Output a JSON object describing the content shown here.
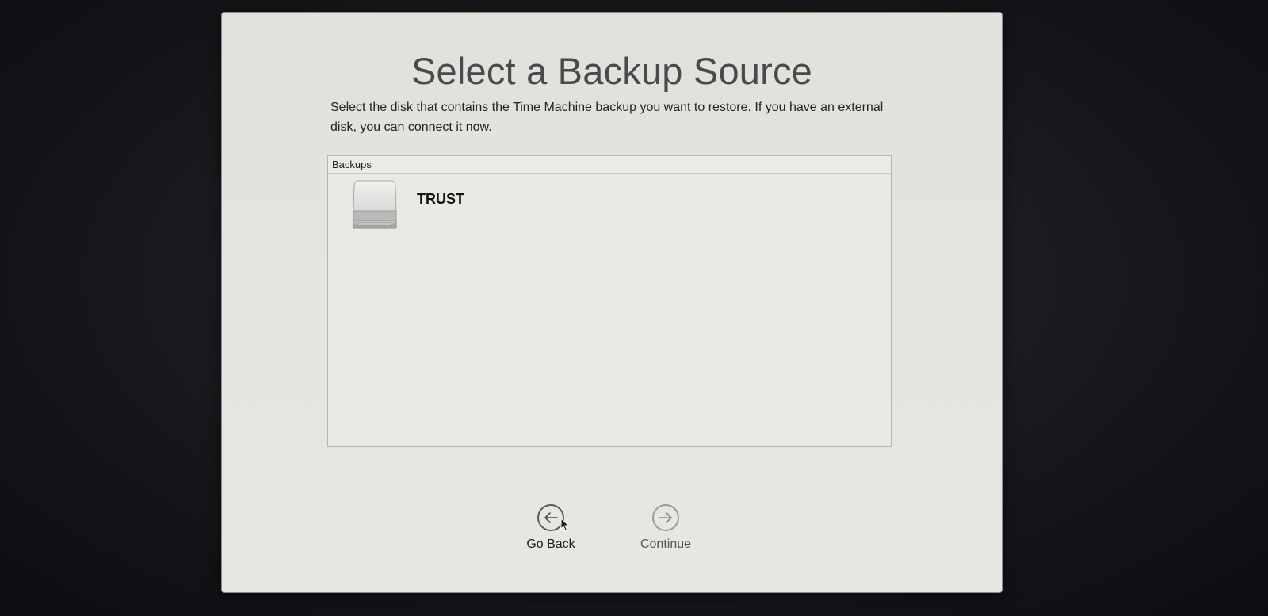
{
  "window": {
    "title": "Select a Backup Source",
    "description": "Select the disk that contains the Time Machine backup you want to restore. If you have an external disk, you can connect it now."
  },
  "backups_list": {
    "header": "Backups",
    "items": [
      {
        "label": "TRUST",
        "icon": "external-disk-icon"
      }
    ]
  },
  "navigation": {
    "go_back_label": "Go Back",
    "continue_label": "Continue",
    "go_back_icon": "arrow-left-circle-icon",
    "continue_icon": "arrow-right-circle-icon"
  },
  "colors": {
    "window_background": "#e4e2de",
    "title_text": "#4a4a4a",
    "disabled_text": "#555555"
  }
}
